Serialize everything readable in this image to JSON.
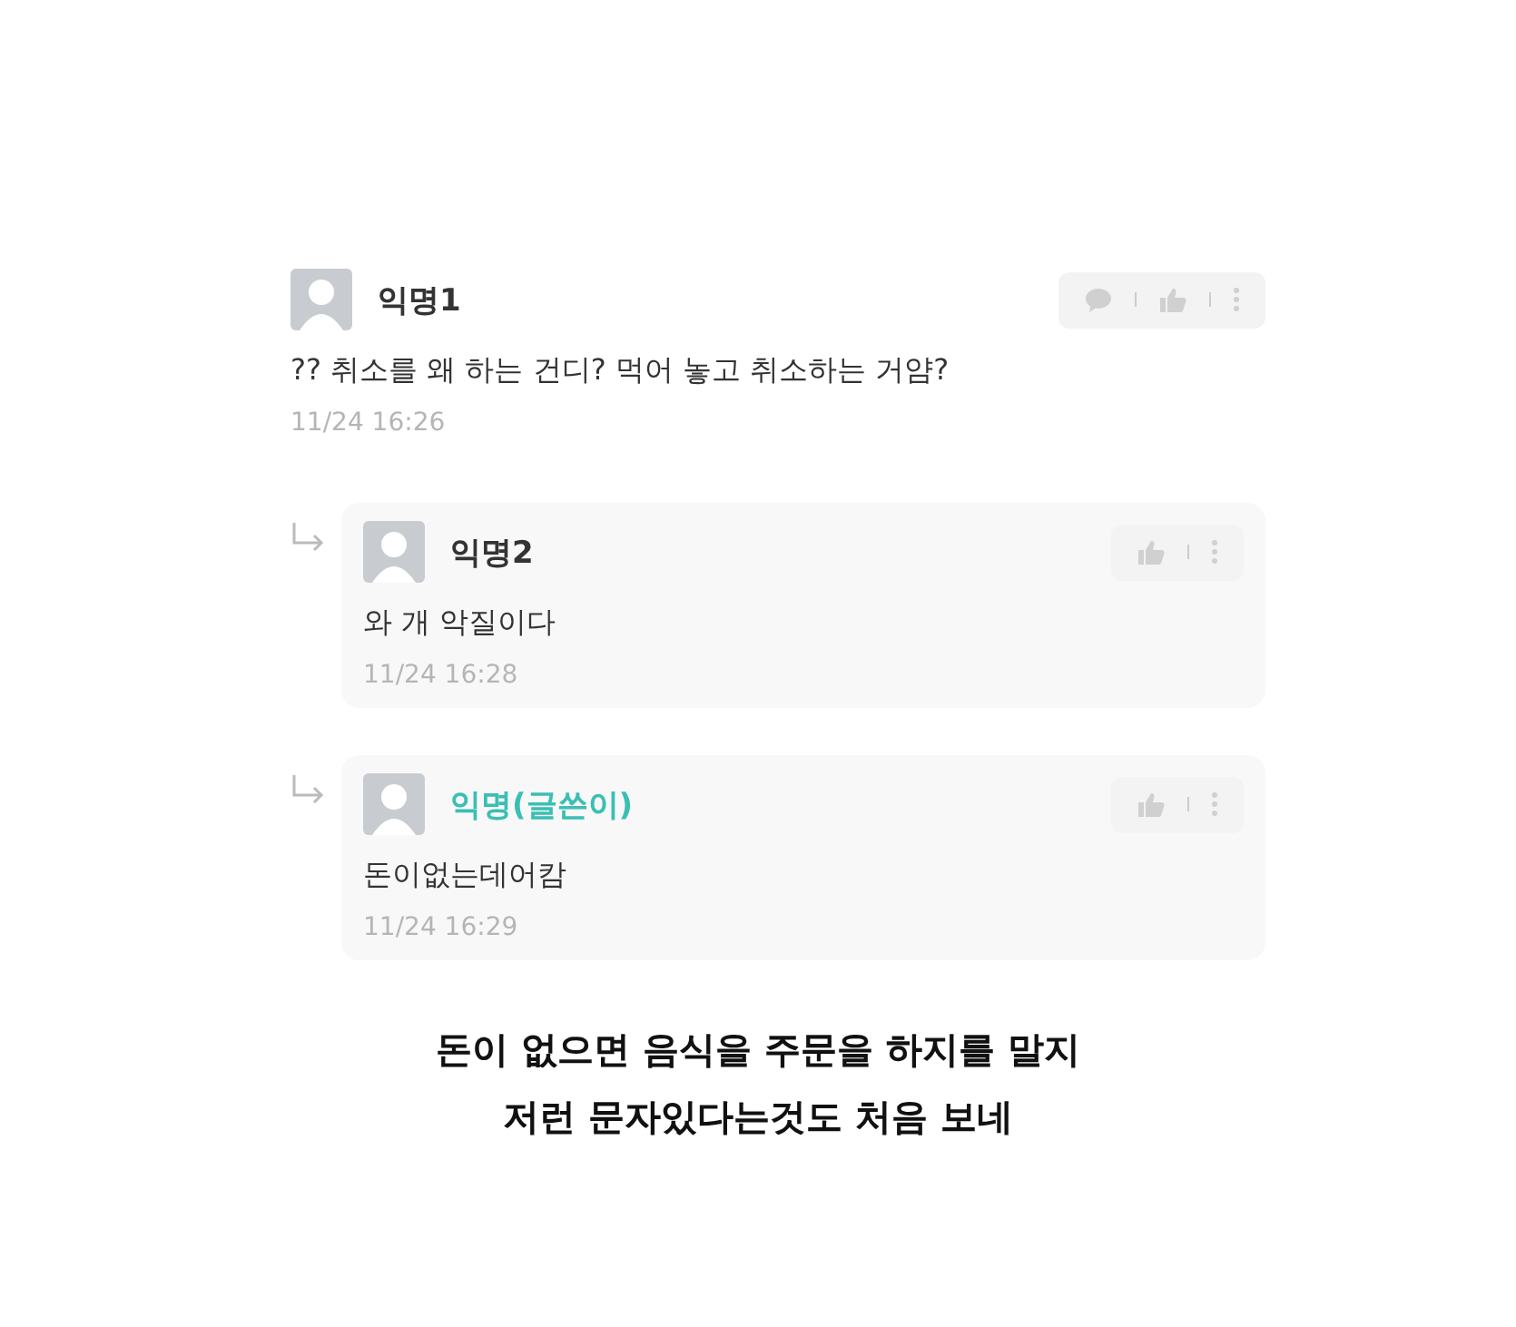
{
  "comments": [
    {
      "kind": "comment",
      "author": "익명1",
      "is_writer": false,
      "text": "?? 취소를 왜 하는 건디? 먹어 놓고 취소하는 거얌?",
      "time": "11/24 16:26"
    },
    {
      "kind": "reply",
      "author": "익명2",
      "is_writer": false,
      "text": "와 개 악질이다",
      "time": "11/24 16:28"
    },
    {
      "kind": "reply",
      "author": "익명(글쓴이)",
      "is_writer": true,
      "text": "돈이없는데어캄",
      "time": "11/24 16:29"
    }
  ],
  "caption": [
    "돈이 없으면 음식을 주문을 하지를 말지",
    "저런 문자있다는것도 처음 보네"
  ]
}
